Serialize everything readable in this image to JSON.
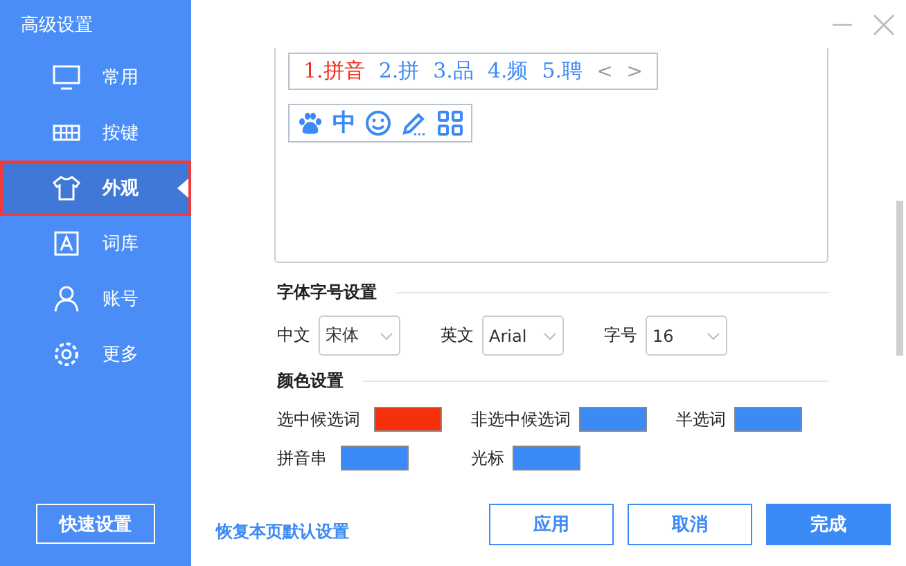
{
  "window": {
    "title": "高级设置"
  },
  "sidebar": {
    "items": [
      {
        "label": "常用",
        "selected": false
      },
      {
        "label": "按键",
        "selected": false
      },
      {
        "label": "外观",
        "selected": true
      },
      {
        "label": "词库",
        "selected": false
      },
      {
        "label": "账号",
        "selected": false
      },
      {
        "label": "更多",
        "selected": false
      }
    ],
    "quick_button": "快速设置"
  },
  "preview": {
    "candidates": [
      {
        "text": "1.拼音",
        "selected": true
      },
      {
        "text": "2.拼",
        "selected": false
      },
      {
        "text": "3.品",
        "selected": false
      },
      {
        "text": "4.频",
        "selected": false
      },
      {
        "text": "5.聘",
        "selected": false
      }
    ],
    "prev": "<",
    "next": ">",
    "toolbar_glyph": "中"
  },
  "font_section": {
    "title": "字体字号设置",
    "fields": [
      {
        "label": "中文",
        "value": "宋体"
      },
      {
        "label": "英文",
        "value": "Arial"
      },
      {
        "label": "字号",
        "value": "16"
      }
    ]
  },
  "color_section": {
    "title": "颜色设置",
    "rows": [
      [
        {
          "label": "选中候选词",
          "color": "#f5300b"
        },
        {
          "label": "非选中候选词",
          "color": "#3c8af5"
        },
        {
          "label": "半选词",
          "color": "#3c8af5"
        }
      ],
      [
        {
          "label": "拼音串",
          "color": "#3c8af5"
        },
        {
          "label": "光标",
          "color": "#3c8af5"
        }
      ]
    ]
  },
  "footer": {
    "restore_link": "恢复本页默认设置",
    "buttons": [
      {
        "label": "应用",
        "kind": "outline"
      },
      {
        "label": "取消",
        "kind": "outline"
      },
      {
        "label": "完成",
        "kind": "primary"
      }
    ]
  }
}
